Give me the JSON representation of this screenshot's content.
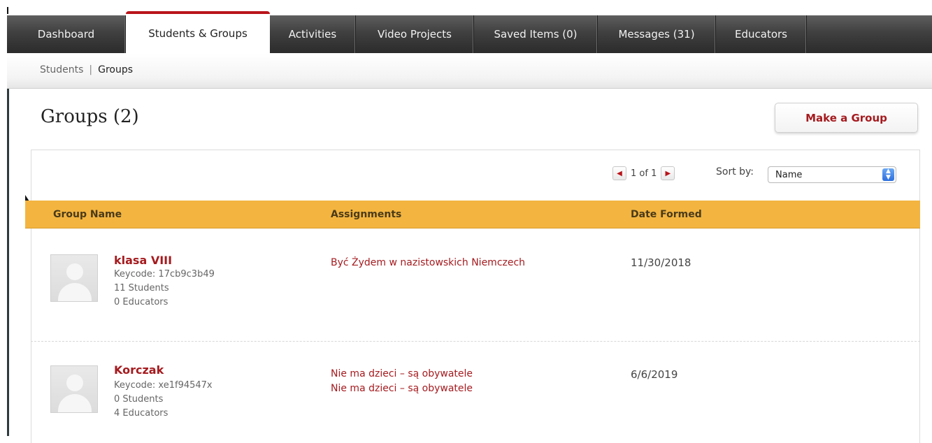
{
  "topnav": {
    "tabs": [
      {
        "label": "Dashboard"
      },
      {
        "label": "Students & Groups"
      },
      {
        "label": "Activities"
      },
      {
        "label": "Video Projects"
      },
      {
        "label": "Saved Items (0)"
      },
      {
        "label": "Messages (31)"
      },
      {
        "label": "Educators"
      }
    ],
    "active": "Students & Groups",
    "accent_color": "#b8141a"
  },
  "subnav": {
    "items": [
      {
        "label": "Students"
      },
      {
        "label": "Groups"
      }
    ],
    "separator": "|",
    "active": "Groups"
  },
  "header": {
    "title": "Groups (2)",
    "make_group_label": "Make a Group"
  },
  "pager": {
    "prev_icon": "triangle-left-icon",
    "text": "1 of 1",
    "next_icon": "triangle-right-icon"
  },
  "sort": {
    "label": "Sort by:",
    "selected": "Name"
  },
  "table": {
    "columns": [
      "Group Name",
      "Assignments",
      "Date Formed"
    ],
    "header_color": "#f3b540",
    "rows": [
      {
        "name": "klasa VIII",
        "keycode": "Keycode: 17cb9c3b49",
        "students": "11 Students",
        "educators": "0 Educators",
        "assignments": [
          "Być Żydem w nazistowskich Niemczech"
        ],
        "date": "11/30/2018"
      },
      {
        "name": "Korczak",
        "keycode": "Keycode: xe1f94547x",
        "students": "0 Students",
        "educators": "4 Educators",
        "assignments": [
          "Nie ma dzieci – są obywatele",
          "Nie ma dzieci – są obywatele"
        ],
        "date": "6/6/2019"
      }
    ]
  }
}
